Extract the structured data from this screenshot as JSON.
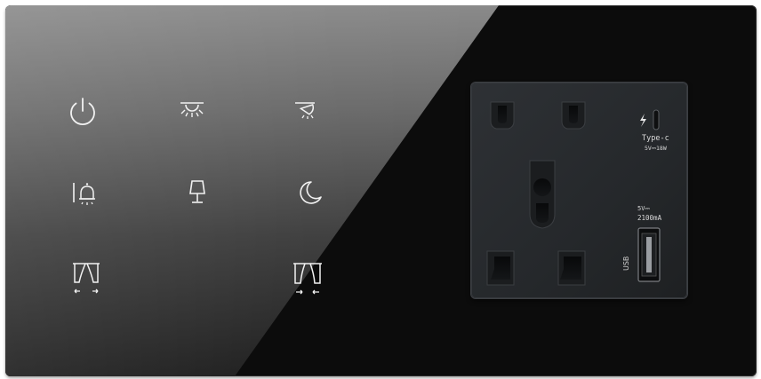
{
  "panel": {
    "keys": [
      {
        "name": "power-key",
        "icon": "power-icon"
      },
      {
        "name": "main-light-key",
        "icon": "ceiling-light-icon"
      },
      {
        "name": "spot-light-key",
        "icon": "spotlight-icon"
      },
      {
        "name": "bell-key",
        "icon": "doorbell-icon"
      },
      {
        "name": "lamp-key",
        "icon": "table-lamp-icon"
      },
      {
        "name": "night-mode-key",
        "icon": "moon-icon"
      },
      {
        "name": "curtain-open-key",
        "icon": "curtain-open-icon"
      },
      {
        "name": "curtain-close-key",
        "icon": "curtain-close-icon"
      }
    ],
    "socket": {
      "type_c_label": "Type-c",
      "type_c_rating": "5V⎓18W",
      "usb_voltage": "5V⎓",
      "usb_current": "2100mA",
      "usb_port_label": "USB"
    },
    "colors": {
      "glass_light": "#7a7a7a",
      "glass_dark": "#0c0c0c",
      "icon": "#f2f2f2",
      "socket": "#2b2e31"
    }
  }
}
